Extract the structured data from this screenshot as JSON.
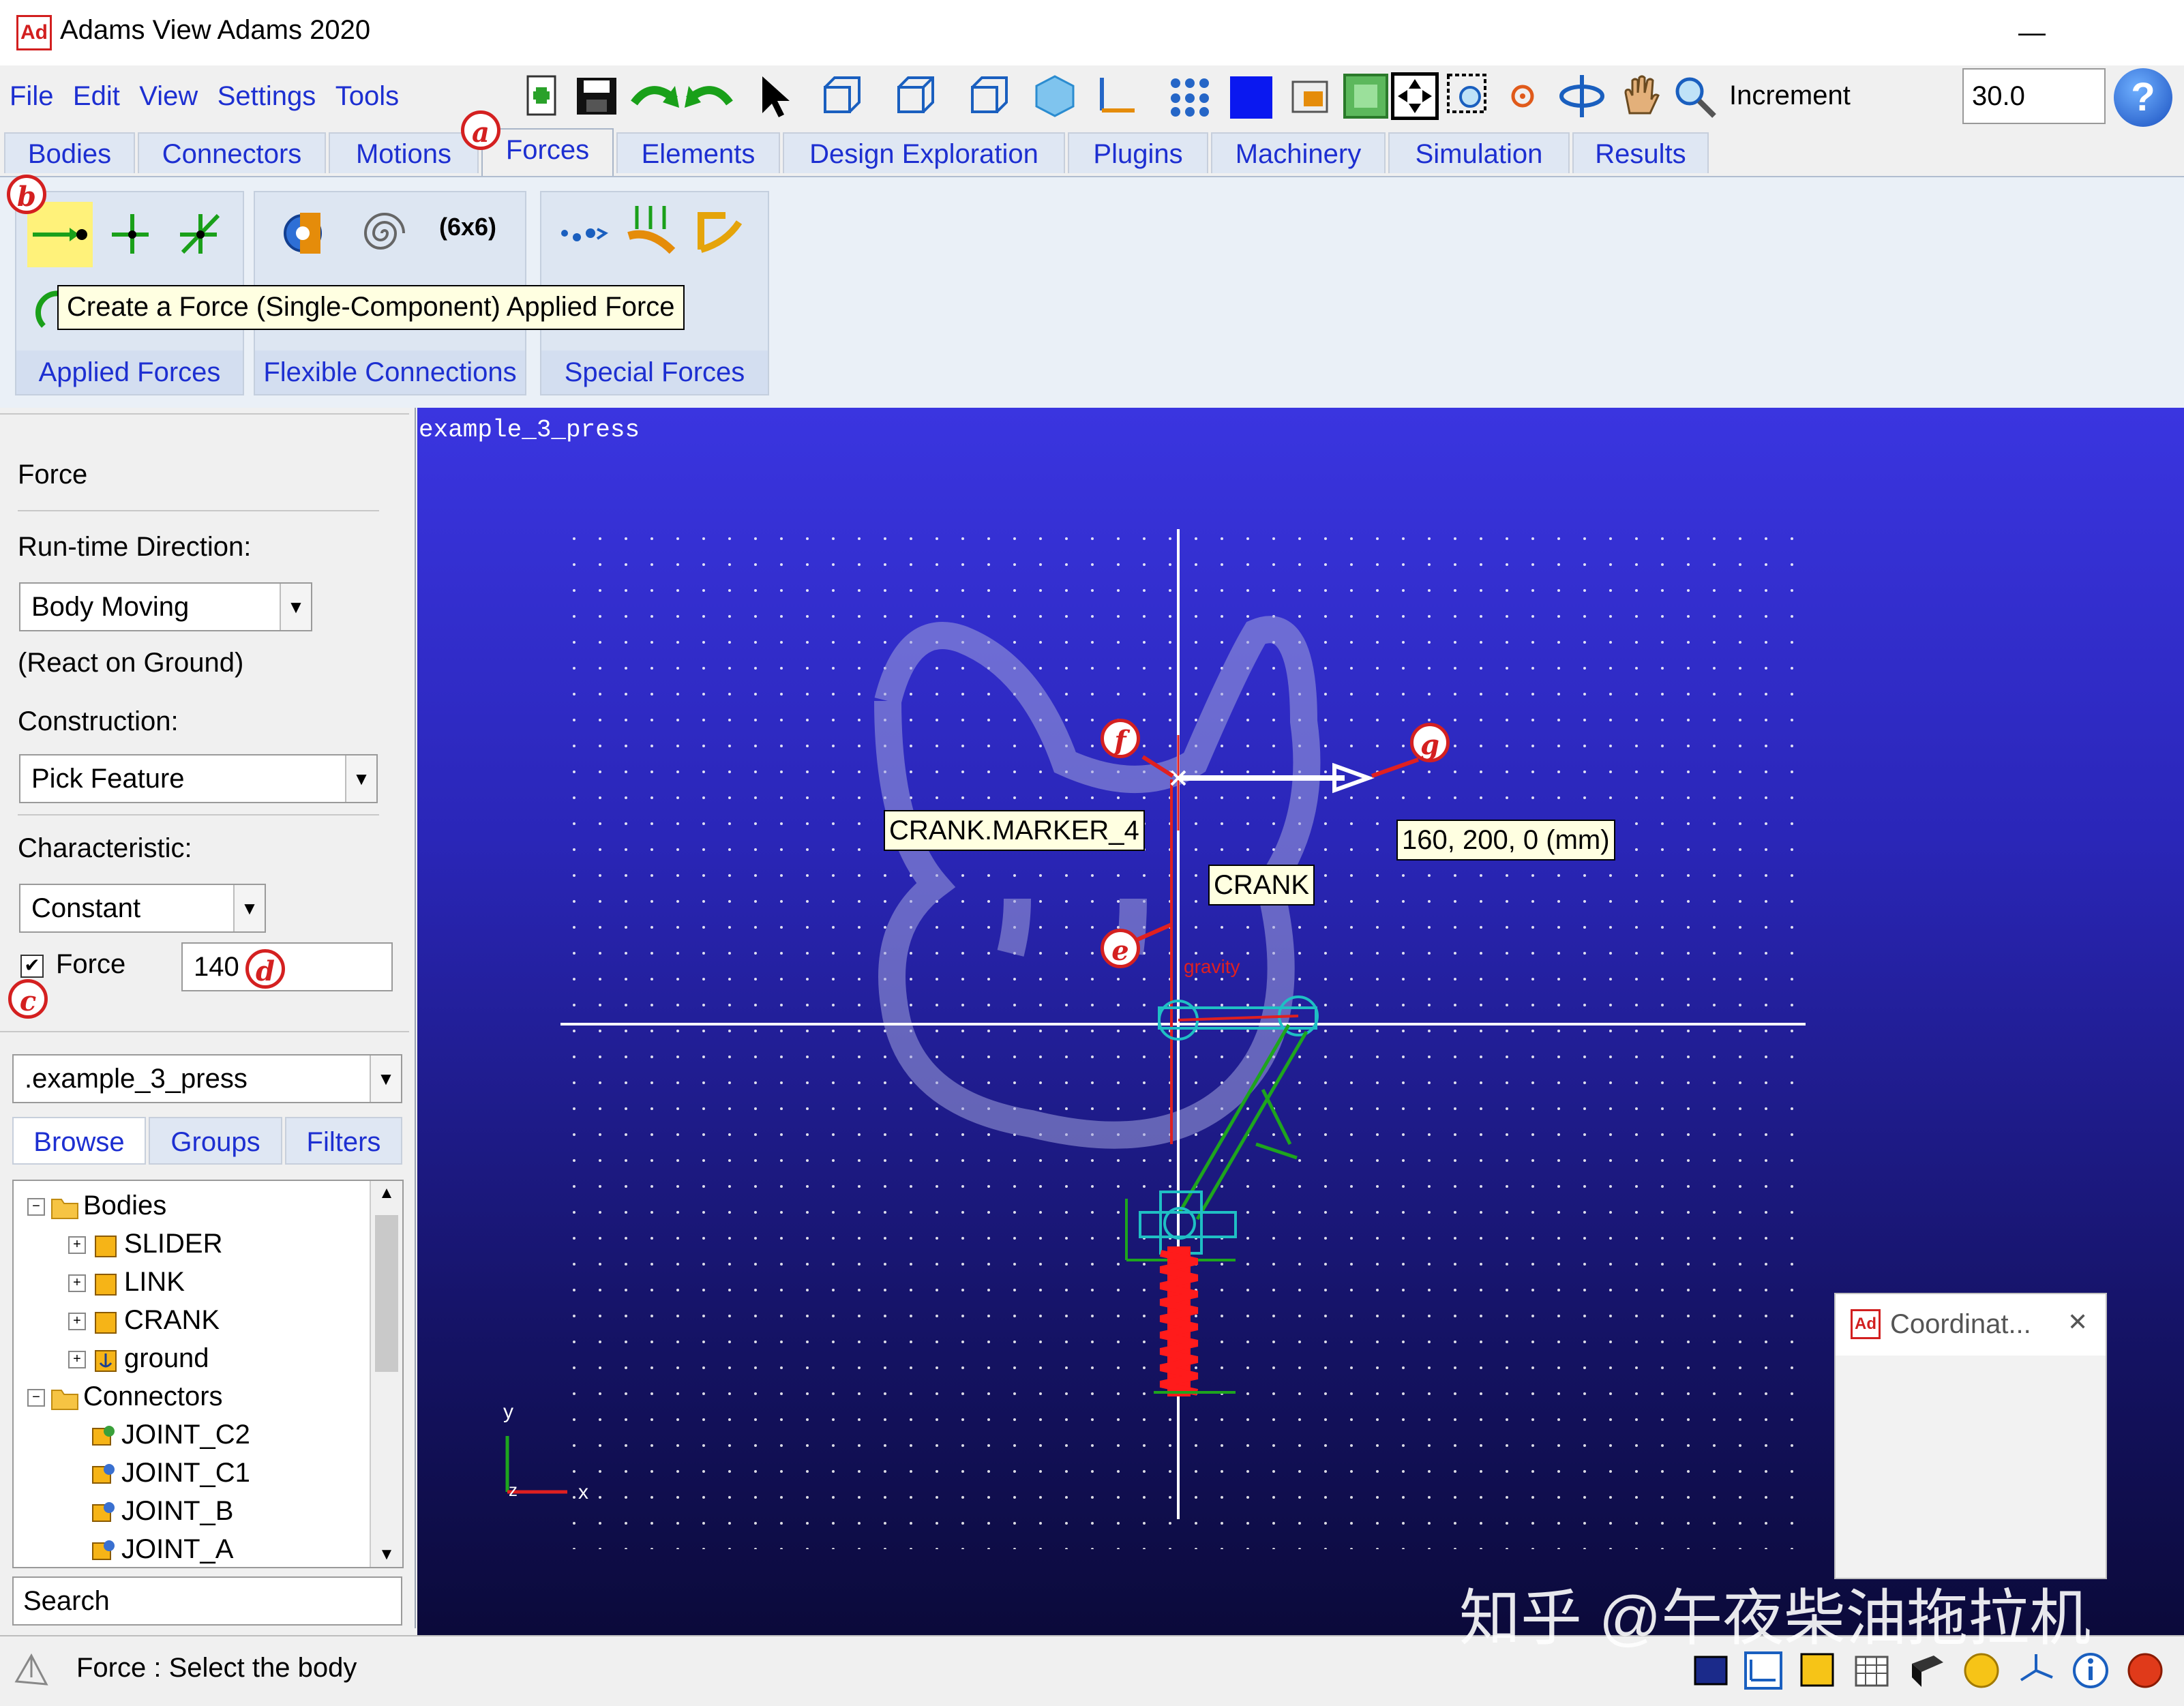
{
  "window": {
    "title": "Adams View Adams 2020",
    "logo_text": "Ad",
    "minimize": "—",
    "maximize": "☐",
    "close": "✕"
  },
  "menu": [
    "File",
    "Edit",
    "View",
    "Settings",
    "Tools"
  ],
  "toolbar": {
    "increment_label": "Increment",
    "increment_value": "30.0",
    "help": "?"
  },
  "tabs": [
    "Bodies",
    "Connectors",
    "Motions",
    "Forces",
    "Elements",
    "Design Exploration",
    "Plugins",
    "Machinery",
    "Simulation",
    "Results"
  ],
  "active_tab": "Forces",
  "ribbon": {
    "groups": [
      "Applied Forces",
      "Flexible Connections",
      "Special Forces"
    ],
    "matrix_label": "(6x6)",
    "tooltip": "Create a Force (Single-Component) Applied Force"
  },
  "callouts": {
    "a": "a",
    "b": "b",
    "c": "c",
    "d": "d",
    "e": "e",
    "f": "f",
    "g": "g"
  },
  "panel": {
    "heading": "Force",
    "runtime_label": "Run-time Direction:",
    "runtime_value": "Body Moving",
    "react_note": "(React on Ground)",
    "construction_label": "Construction:",
    "construction_value": "Pick Feature",
    "characteristic_label": "Characteristic:",
    "characteristic_value": "Constant",
    "force_checkbox_label": "Force",
    "force_checked": true,
    "force_value": "140"
  },
  "browser": {
    "model": ".example_3_press",
    "tabs": [
      "Browse",
      "Groups",
      "Filters"
    ],
    "tree": {
      "bodies_label": "Bodies",
      "bodies": [
        "SLIDER",
        "LINK",
        "CRANK",
        "ground"
      ],
      "connectors_label": "Connectors",
      "connectors": [
        "JOINT_C2",
        "JOINT_C1",
        "JOINT_B",
        "JOINT_A"
      ]
    },
    "search_placeholder": "Search"
  },
  "viewport": {
    "model_name": "example_3_press",
    "marker_label": "CRANK.MARKER_4",
    "body_label": "CRANK",
    "coordinate_label": "160, 200, 0 (mm)",
    "gravity_text": "gravity",
    "axis_x": "x",
    "axis_y": "y",
    "axis_z": "z"
  },
  "coord_dialog": {
    "title": "Coordinat...",
    "close": "✕"
  },
  "status": {
    "text": "Force : Select the body"
  },
  "watermark": "知乎 @午夜柴油拖拉机",
  "colors": {
    "menu_blue": "#1d2fd1",
    "callout_red": "#d42020",
    "viewport_top": "#3a35e0",
    "viewport_bottom": "#0b0a3a"
  }
}
